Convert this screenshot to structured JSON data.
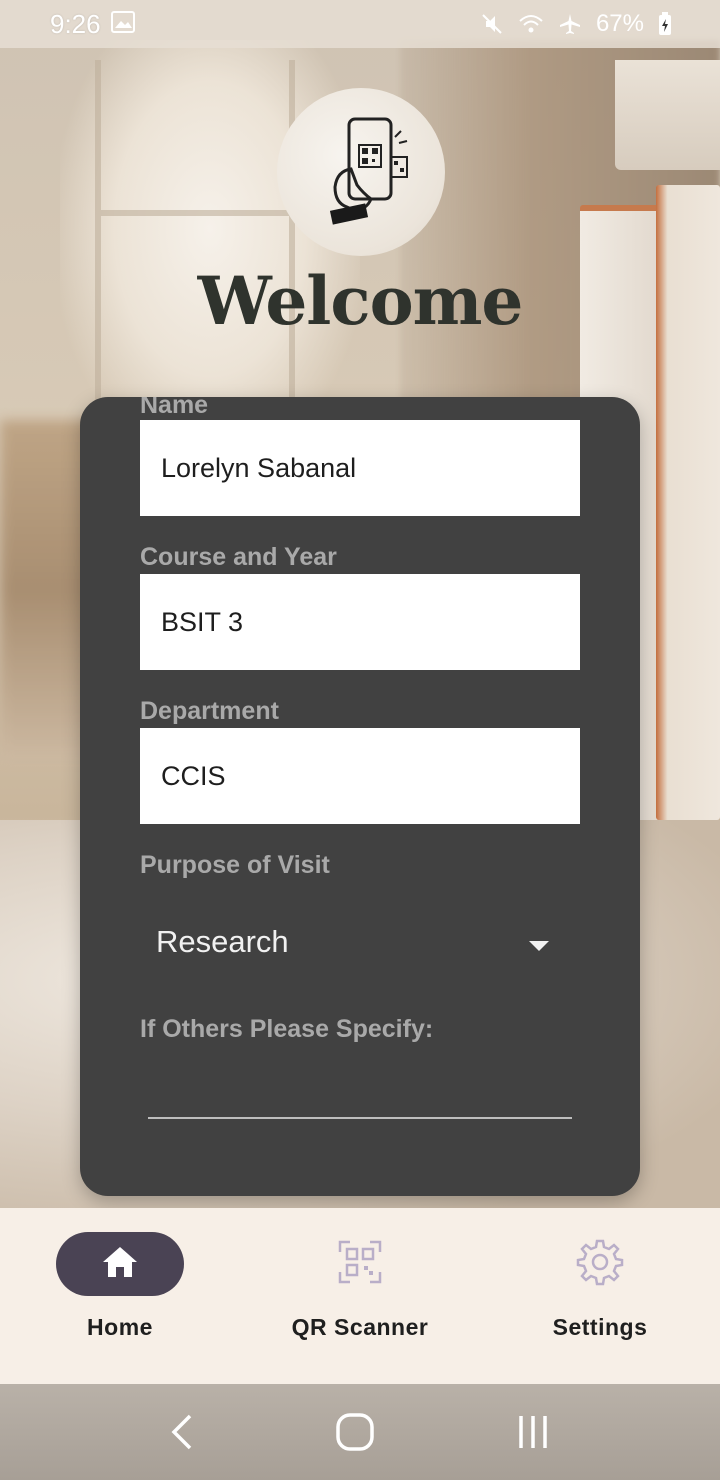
{
  "status_bar": {
    "time": "9:26",
    "battery": "67%",
    "icons": [
      "image-icon",
      "mute-icon",
      "wifi-icon",
      "airplane-icon",
      "battery-icon"
    ]
  },
  "header": {
    "logo": "qr-phone-hand-icon",
    "title": "Welcome"
  },
  "form": {
    "name": {
      "label": "Name",
      "value": "Lorelyn Sabanal"
    },
    "course_year": {
      "label": "Course and Year",
      "value": "BSIT 3"
    },
    "department": {
      "label": "Department",
      "value": "CCIS"
    },
    "purpose": {
      "label": "Purpose of Visit",
      "selected": "Research"
    },
    "others": {
      "label": "If Others Please Specify:",
      "value": ""
    }
  },
  "bottom_nav": {
    "items": [
      {
        "label": "Home",
        "icon": "home-icon",
        "active": true
      },
      {
        "label": "QR Scanner",
        "icon": "qr-scanner-icon",
        "active": false
      },
      {
        "label": "Settings",
        "icon": "gear-icon",
        "active": false
      }
    ]
  },
  "system_nav": {
    "icons": [
      "back-icon",
      "home-circle-icon",
      "recents-icon"
    ]
  },
  "colors": {
    "card": "#414141",
    "label": "#a9a9a9",
    "nav_bg": "#f7efe7",
    "nav_active": "#4a4354",
    "title": "#2f332d"
  }
}
